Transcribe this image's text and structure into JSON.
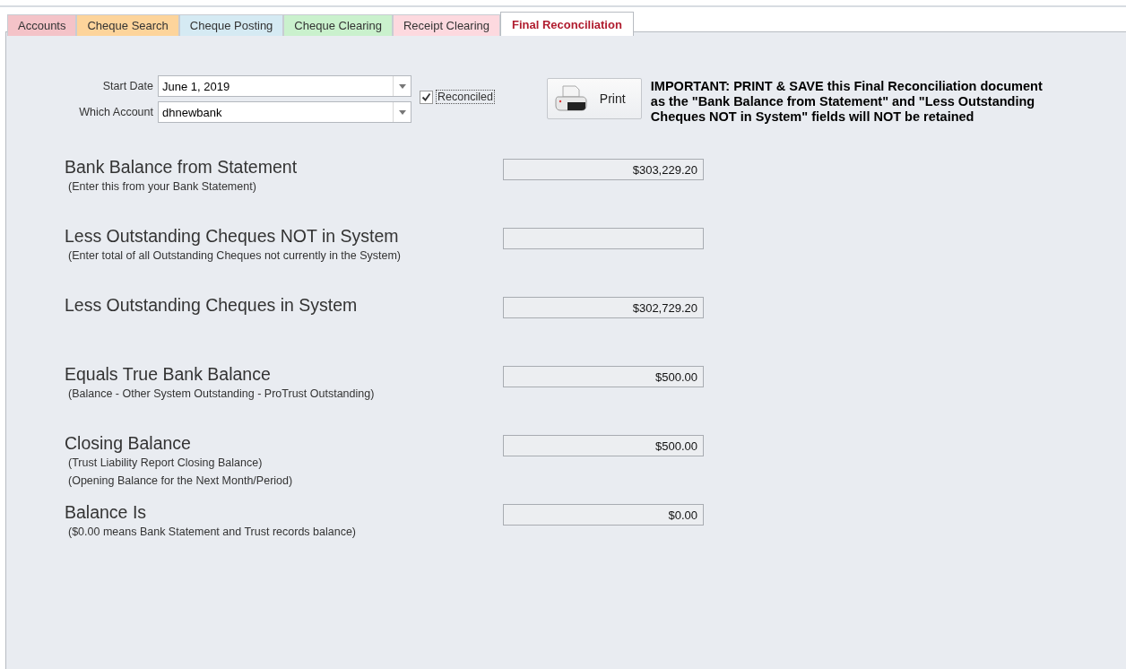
{
  "tabs": [
    {
      "label": "Accounts",
      "selected": false,
      "color": "#f4c3c8"
    },
    {
      "label": "Cheque Search",
      "selected": false,
      "color": "#fdd49b"
    },
    {
      "label": "Cheque Posting",
      "selected": false,
      "color": "#d5eaf3"
    },
    {
      "label": "Cheque Clearing",
      "selected": false,
      "color": "#caf1cd"
    },
    {
      "label": "Receipt Clearing",
      "selected": false,
      "color": "#fdd9df"
    },
    {
      "label": "Final Reconciliation",
      "selected": true,
      "color": "#ffffff"
    }
  ],
  "filters": [
    {
      "label": "Start Date",
      "value": "June 1, 2019"
    },
    {
      "label": "Which Account",
      "value": "dhnewbank"
    }
  ],
  "reconciled": {
    "label": "Reconciled",
    "checked": true
  },
  "print_button": {
    "label": "Print"
  },
  "notice": [
    "IMPORTANT: PRINT & SAVE this Final Reconciliation document",
    "as the \"Bank Balance from Statement\" and \"Less Outstanding",
    "Cheques NOT in System\" fields will NOT be retained"
  ],
  "rows": [
    {
      "title": "Bank Balance from Statement",
      "notes": [
        "(Enter this from your Bank Statement)"
      ],
      "value": "$303,229.20"
    },
    {
      "title": "Less Outstanding Cheques NOT in System",
      "notes": [
        "(Enter total of all Outstanding Cheques not currently in the System)"
      ]
    },
    {
      "title": "Less Outstanding Cheques in System",
      "notes": [],
      "value": "$302,729.20"
    },
    {
      "title": "Equals True Bank Balance",
      "notes": [
        "(Balance - Other System Outstanding - ProTrust Outstanding)"
      ],
      "value": "$500.00"
    },
    {
      "title": "Closing Balance",
      "notes": [
        "(Trust Liability Report Closing Balance)",
        "(Opening Balance for the Next Month/Period)"
      ],
      "value": "$500.00"
    },
    {
      "title": "Balance Is",
      "notes": [
        "($0.00 means Bank Statement and Trust records balance)"
      ],
      "value": "$0.00"
    }
  ]
}
